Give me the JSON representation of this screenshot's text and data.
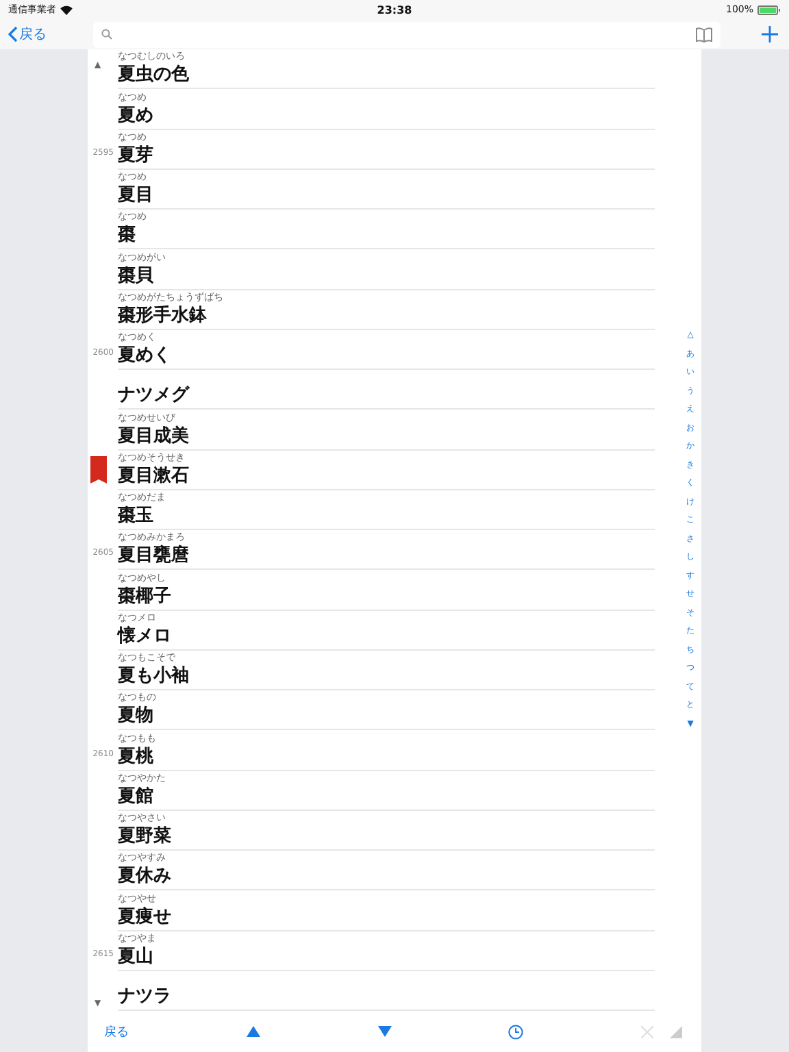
{
  "status_bar": {
    "carrier": "通信事業者",
    "time": "23:38",
    "battery": "100%"
  },
  "nav": {
    "back": "戻る"
  },
  "list_top_marker": "▲",
  "list_bottom_marker": "▼",
  "entries": [
    {
      "reading": "なつむしのいろ",
      "word": "夏虫の色",
      "bookmarked": false
    },
    {
      "reading": "なつめ",
      "word": "夏め",
      "bookmarked": false
    },
    {
      "reading": "なつめ",
      "word": "夏芽",
      "line_number": "2595",
      "bookmarked": false
    },
    {
      "reading": "なつめ",
      "word": "夏目",
      "bookmarked": false
    },
    {
      "reading": "なつめ",
      "word": "棗",
      "bookmarked": false
    },
    {
      "reading": "なつめがい",
      "word": "棗貝",
      "bookmarked": false
    },
    {
      "reading": "なつめがたちょうずばち",
      "word": "棗形手水鉢",
      "bookmarked": false
    },
    {
      "reading": "なつめく",
      "word": "夏めく",
      "line_number": "2600",
      "bookmarked": false
    },
    {
      "word": "ナツメグ",
      "bookmarked": false
    },
    {
      "reading": "なつめせいび",
      "word": "夏目成美",
      "bookmarked": false
    },
    {
      "reading": "なつめそうせき",
      "word": "夏目漱石",
      "bookmarked": true
    },
    {
      "reading": "なつめだま",
      "word": "棗玉",
      "bookmarked": false
    },
    {
      "reading": "なつめみかまろ",
      "word": "夏目甕麿",
      "line_number": "2605",
      "bookmarked": false
    },
    {
      "reading": "なつめやし",
      "word": "棗椰子",
      "bookmarked": false
    },
    {
      "reading": "なつメロ",
      "word": "懐メロ",
      "bookmarked": false
    },
    {
      "reading": "なつもこそで",
      "word": "夏も小袖",
      "bookmarked": false
    },
    {
      "reading": "なつもの",
      "word": "夏物",
      "bookmarked": false
    },
    {
      "reading": "なつもも",
      "word": "夏桃",
      "line_number": "2610",
      "bookmarked": false
    },
    {
      "reading": "なつやかた",
      "word": "夏館",
      "bookmarked": false
    },
    {
      "reading": "なつやさい",
      "word": "夏野菜",
      "bookmarked": false
    },
    {
      "reading": "なつやすみ",
      "word": "夏休み",
      "bookmarked": false
    },
    {
      "reading": "なつやせ",
      "word": "夏痩せ",
      "bookmarked": false
    },
    {
      "reading": "なつやま",
      "word": "夏山",
      "line_number": "2615",
      "bookmarked": false
    },
    {
      "word": "ナツラ",
      "bookmarked": false
    }
  ],
  "index": [
    "△",
    "あ",
    "い",
    "う",
    "え",
    "お",
    "か",
    "き",
    "く",
    "け",
    "こ",
    "さ",
    "し",
    "す",
    "せ",
    "そ",
    "た",
    "ち",
    "つ",
    "て",
    "と",
    "▼"
  ],
  "toolbar": {
    "back": "戻る",
    "close_disabled": true
  }
}
